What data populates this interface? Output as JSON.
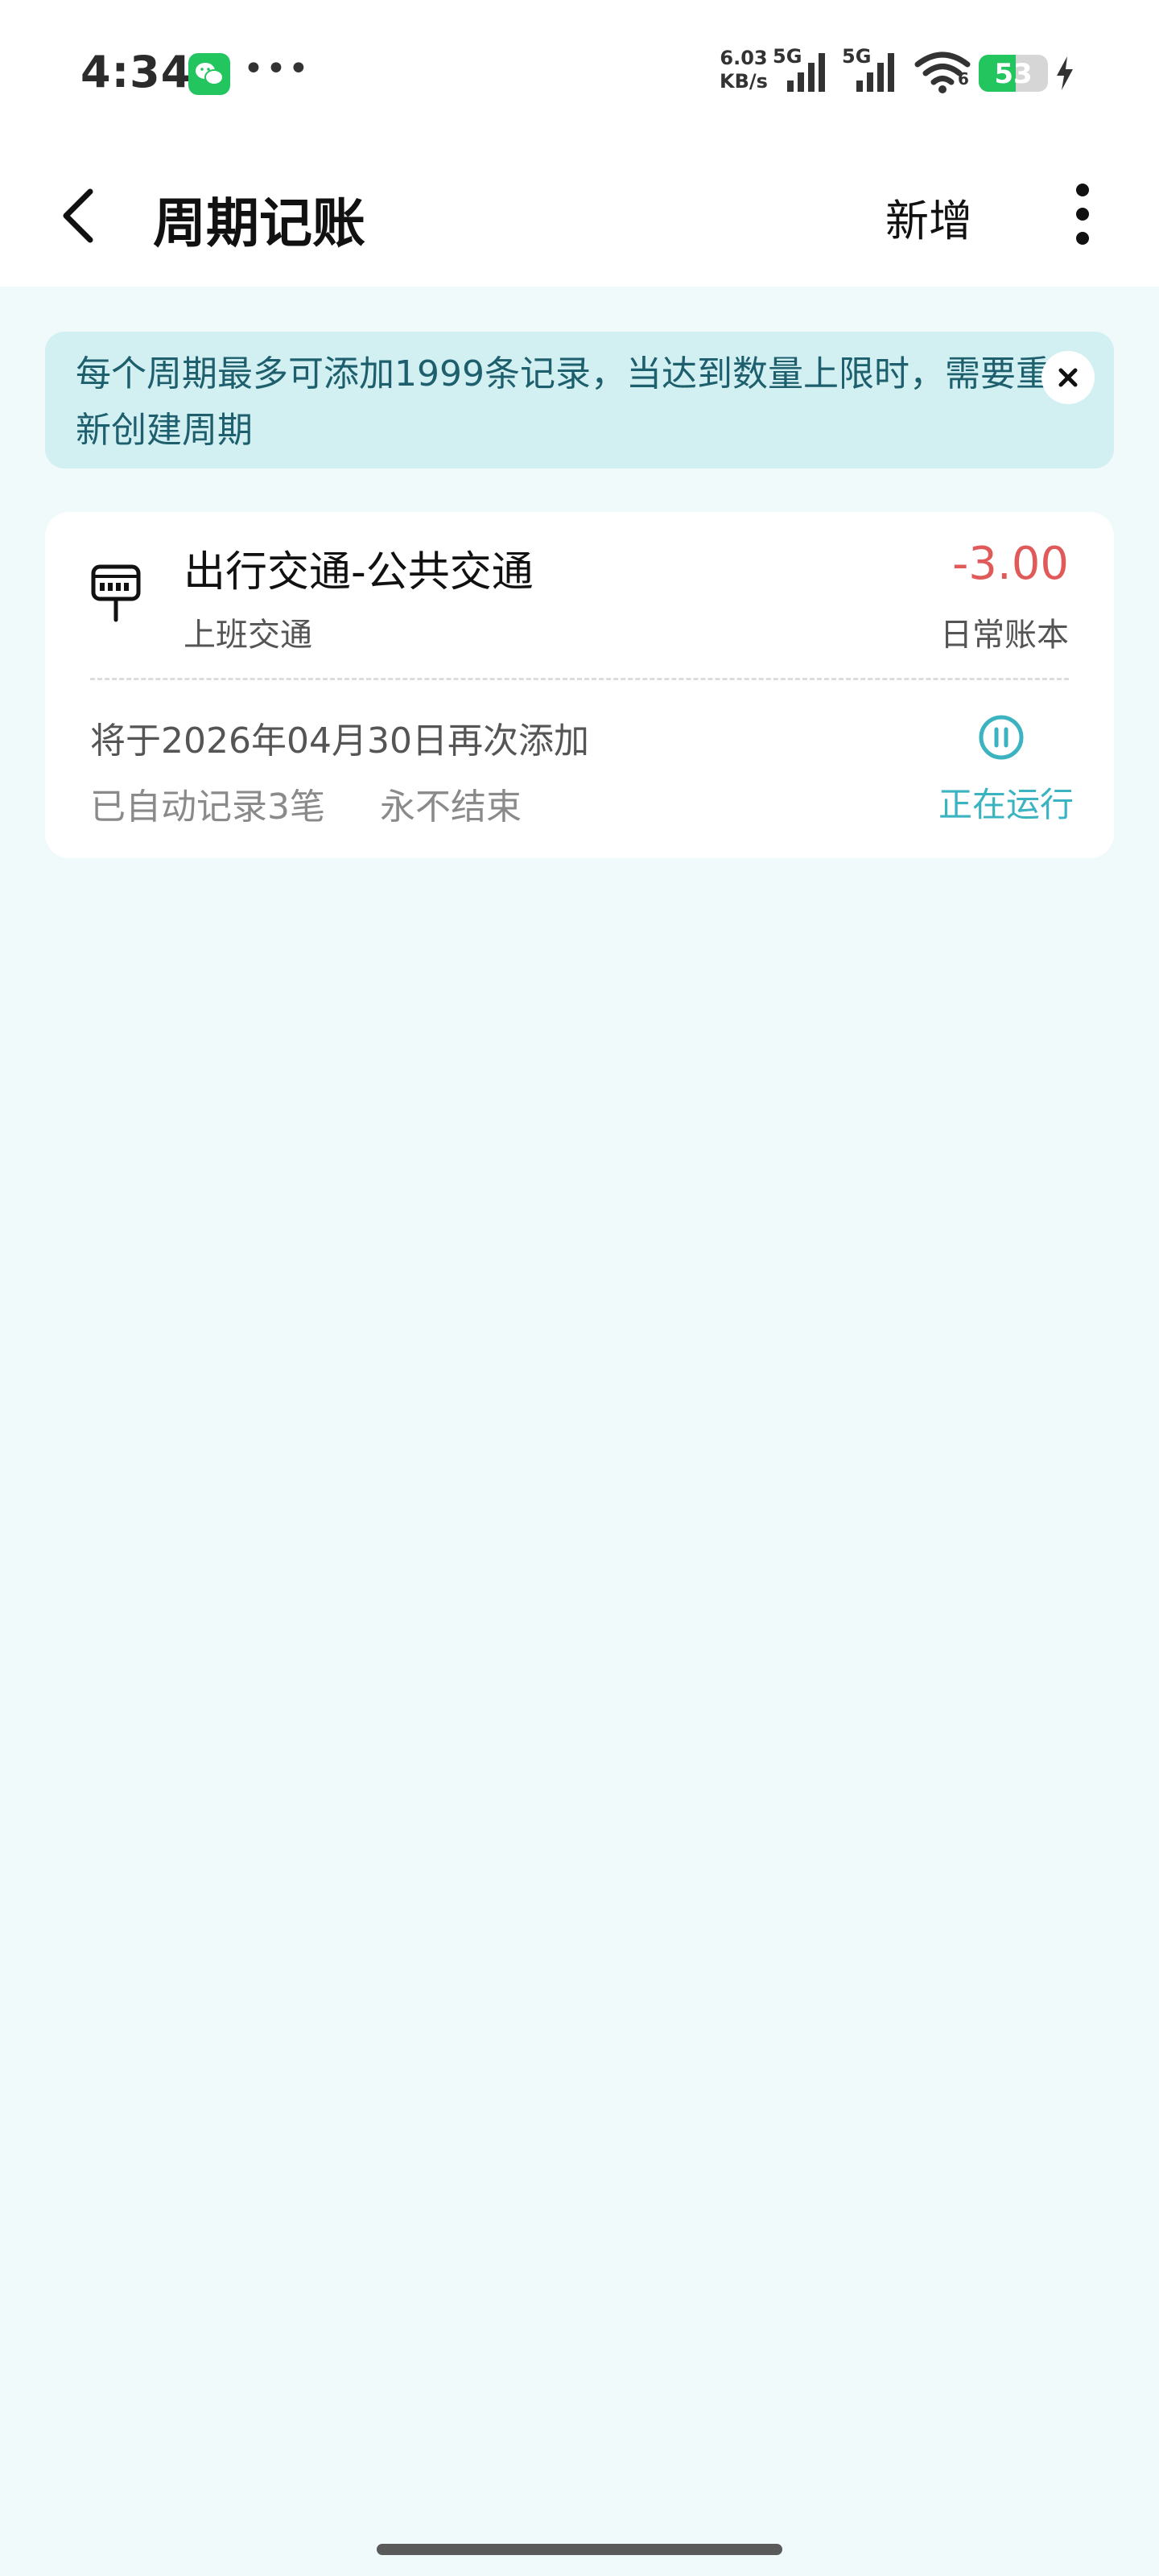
{
  "status_bar": {
    "time": "4:34",
    "net_speed_value": "6.03",
    "net_speed_unit": "KB/s",
    "sim1_label": "5G",
    "sim2_label": "5G",
    "wifi_label": "6",
    "battery_level": "53",
    "battery_fraction": 0.53,
    "icons": [
      "wechat-icon",
      "more-dots-icon",
      "signal-icon",
      "wifi-icon",
      "battery-icon",
      "charging-icon"
    ]
  },
  "app_bar": {
    "title": "周期记账",
    "add_label": "新增",
    "icons": [
      "back-arrow-icon",
      "overflow-menu-icon"
    ]
  },
  "notice": {
    "text": "每个周期最多可添加1999条记录，当达到数量上限时，需要重新创建周期",
    "icon": "close-icon"
  },
  "records": [
    {
      "category": "出行交通-公共交通",
      "note": "上班交通",
      "amount": "-3.00",
      "book": "日常账本",
      "next_date": "将于2026年04月30日再次添加",
      "auto_count": "已自动记录3笔",
      "end_rule": "永不结束",
      "status": "正在运行",
      "icon": "bus-card-icon",
      "status_icon": "pause-icon"
    }
  ],
  "colors": {
    "background": "#f1fafa",
    "notice_bg": "#d2eff2",
    "notice_text": "#1d5f6d",
    "amount": "#e05a5a",
    "accent": "#3bb3c0",
    "battery": "#22c55e"
  }
}
